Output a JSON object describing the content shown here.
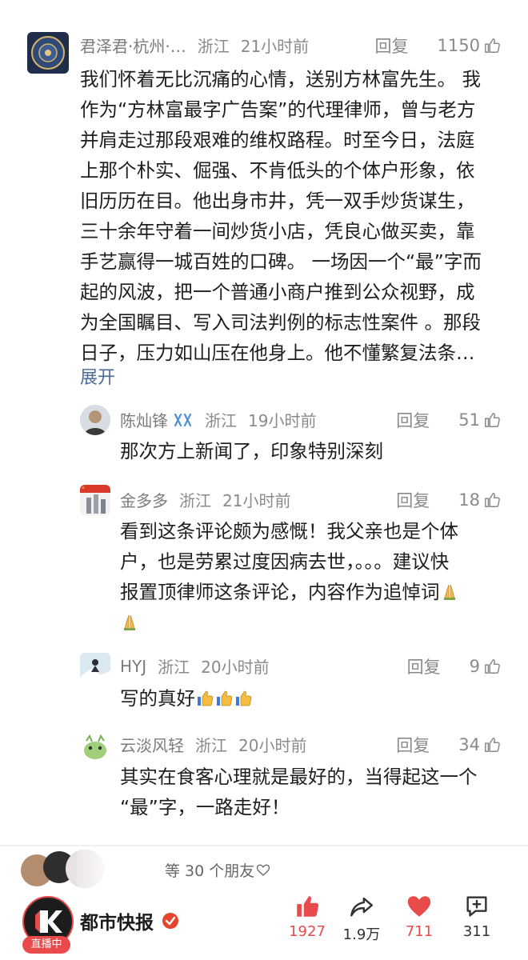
{
  "comments": [
    {
      "user": "君泽君·杭州·…",
      "location": "浙江",
      "time": "21小时前",
      "reply_label": "回复",
      "likes": "1150",
      "lines": [
        "我们怀着无比沉痛的心情，送别方林富先生。 我",
        "作为“方林富最字广告案”的代理律师，曾与老方",
        "并肩走过那段艰难的维权路程。时至今日，法庭",
        "上那个朴实、倔强、不肯低头的个体户形象，依",
        "旧历历在目。他出身市井，凭一双手炒货谋生，",
        "三十余年守着一间炒货小店，凭良心做买卖，靠",
        "手艺赢得一城百姓的口碑。 一场因一个“最”字而",
        "起的风波，把一个普通小商户推到公众视野，成",
        "为全国瞩目、写入司法判例的标志性案件 。那段",
        "日子，压力如山压在他身上。他不懂繁复法条…"
      ],
      "expand_label": "展开"
    },
    {
      "user": "陈灿锋",
      "location": "浙江",
      "time": "19小时前",
      "reply_label": "回复",
      "likes": "51",
      "lines": [
        "那次方上新闻了，印象特别深刻"
      ]
    },
    {
      "user": "金多多",
      "location": "浙江",
      "time": "21小时前",
      "reply_label": "回复",
      "likes": "18",
      "lines": [
        "看到这条评论颇为感慨！我父亲也是个体",
        "户，也是劳累过度因病去世，。。。建议快",
        "报置顶律师这条评论，内容作为追悼词",
        ""
      ]
    },
    {
      "user": "HYJ",
      "location": "浙江",
      "time": "20小时前",
      "reply_label": "回复",
      "likes": "9",
      "lines": [
        "写的真好"
      ]
    },
    {
      "user": "云淡风轻",
      "location": "浙江",
      "time": "20小时前",
      "reply_label": "回复",
      "likes": "34",
      "lines": [
        "其实在食客心理就是最好的，当得起这一个",
        "“最”字，一路走好！"
      ]
    }
  ],
  "friends_liked": "等 30 个朋友",
  "bottom": {
    "account_name": "都市快报",
    "live_badge": "直播中",
    "likes": "1927",
    "shares": "1.9万",
    "favorites": "711",
    "comments": "311"
  },
  "colors": {
    "like_red": "#e94a4a",
    "verified_red": "#e5452b",
    "link_blue": "#4a6a9a"
  }
}
